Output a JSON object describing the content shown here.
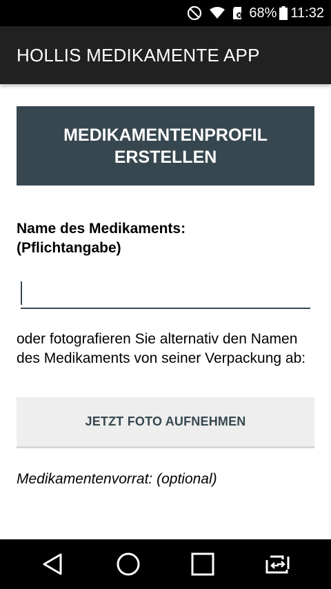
{
  "status_bar": {
    "battery": "68%",
    "time": "11:32",
    "icons": [
      "do-not-disturb-icon",
      "wifi-icon",
      "sd-card-icon",
      "battery-icon"
    ]
  },
  "app_bar": {
    "title": "HOLLIS MEDIKAMENTE APP"
  },
  "form": {
    "header": "MEDIKAMENTENPROFIL ERSTELLEN",
    "name_label_line1": "Name des Medikaments:",
    "name_label_line2": "(Pflichtangabe)",
    "name_input_value": "",
    "helper_text": "oder fotografieren Sie alternativ den Namen des Medikaments von seiner Verpackung ab:",
    "photo_button": "JETZT FOTO AUFNEHMEN",
    "stock_label": "Medikamentenvorrat: (optional)"
  },
  "nav_bar": {
    "icons": [
      "back-icon",
      "home-icon",
      "recents-icon",
      "screen-rotate-icon"
    ]
  },
  "colors": {
    "header_box": "#37474f",
    "app_bar": "#212121",
    "button_bg": "#eeeeee"
  }
}
